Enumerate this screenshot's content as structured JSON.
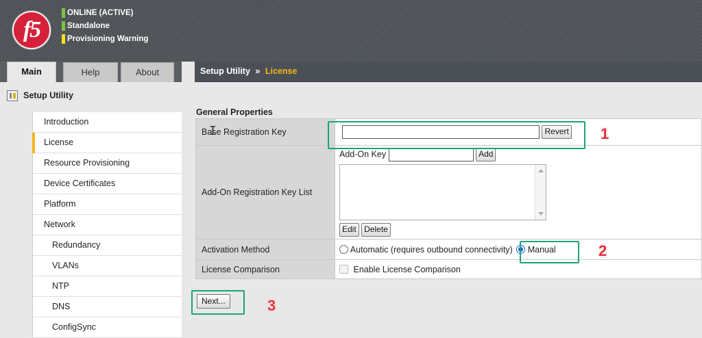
{
  "header": {
    "logo_text": "f5",
    "status": [
      {
        "label": "ONLINE (ACTIVE)",
        "color": "#7ec241"
      },
      {
        "label": "Standalone",
        "color": "#7ec241"
      },
      {
        "label": "Provisioning Warning",
        "color": "#f4e21a"
      }
    ]
  },
  "tabs": [
    {
      "label": "Main",
      "active": true
    },
    {
      "label": "Help",
      "active": false
    },
    {
      "label": "About",
      "active": false
    }
  ],
  "breadcrumb": {
    "root": "Setup Utility",
    "separator": "»",
    "current": "License"
  },
  "sidebar": {
    "title": "Setup Utility",
    "items": [
      {
        "label": "Introduction",
        "sub": false,
        "active": false
      },
      {
        "label": "License",
        "sub": false,
        "active": true
      },
      {
        "label": "Resource Provisioning",
        "sub": false,
        "active": false
      },
      {
        "label": "Device Certificates",
        "sub": false,
        "active": false
      },
      {
        "label": "Platform",
        "sub": false,
        "active": false
      },
      {
        "label": "Network",
        "sub": false,
        "active": false
      },
      {
        "label": "Redundancy",
        "sub": true,
        "active": false
      },
      {
        "label": "VLANs",
        "sub": true,
        "active": false
      },
      {
        "label": "NTP",
        "sub": true,
        "active": false
      },
      {
        "label": "DNS",
        "sub": true,
        "active": false
      },
      {
        "label": "ConfigSync",
        "sub": true,
        "active": false
      }
    ]
  },
  "form": {
    "section_title": "General Properties",
    "base_key": {
      "label": "Base Registration Key",
      "value": "",
      "revert_label": "Revert"
    },
    "addon": {
      "label": "Add-On Registration Key List",
      "key_label": "Add-On Key",
      "key_value": "",
      "add_label": "Add",
      "edit_label": "Edit",
      "delete_label": "Delete"
    },
    "activation": {
      "label": "Activation Method",
      "options": [
        {
          "label": "Automatic (requires outbound connectivity)",
          "checked": false
        },
        {
          "label": "Manual",
          "checked": true
        }
      ]
    },
    "comparison": {
      "label": "License Comparison",
      "checkbox_label": "Enable License Comparison",
      "checked": false
    },
    "next_label": "Next..."
  },
  "annotations": {
    "highlight_color": "#1aa37a",
    "number_color": "#e0303a",
    "numbers": [
      "1",
      "2",
      "3"
    ]
  }
}
